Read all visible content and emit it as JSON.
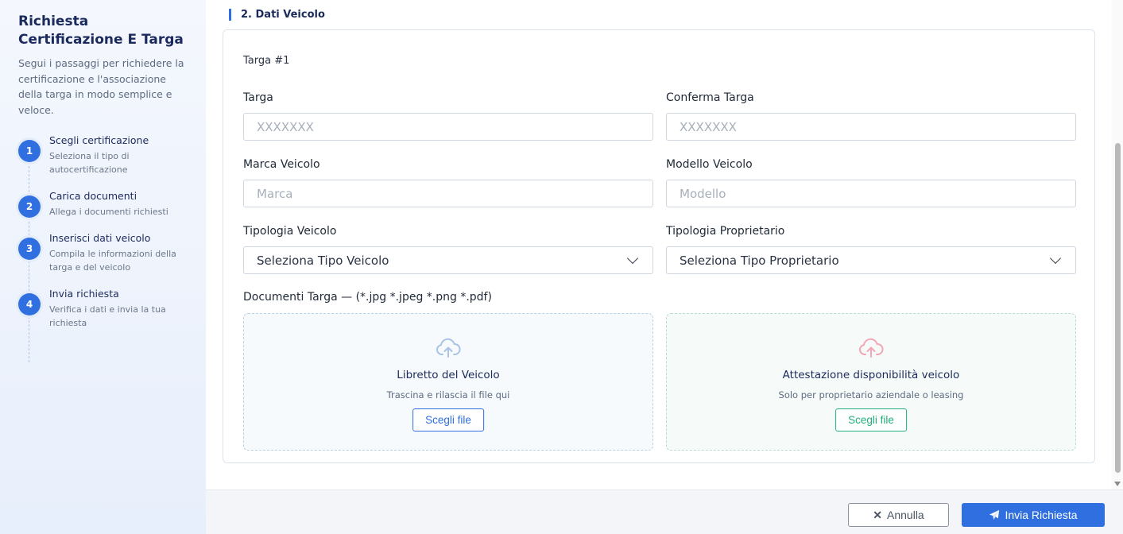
{
  "sidebar": {
    "title": "Richiesta Certificazione E Targa",
    "description": "Segui i passaggi per richiedere la certificazione e l'associazione della targa in modo semplice e veloce.",
    "steps": [
      {
        "num": "1",
        "title": "Scegli certificazione",
        "subtitle": "Seleziona il tipo di autocertificazione"
      },
      {
        "num": "2",
        "title": "Carica documenti",
        "subtitle": "Allega i documenti richiesti"
      },
      {
        "num": "3",
        "title": "Inserisci dati veicolo",
        "subtitle": "Compila le informazioni della targa e del veicolo"
      },
      {
        "num": "4",
        "title": "Invia richiesta",
        "subtitle": "Verifica i dati e invia la tua richiesta"
      }
    ]
  },
  "section": {
    "title": "2. Dati Veicolo"
  },
  "form": {
    "heading": "Targa #1",
    "targa": {
      "label": "Targa",
      "placeholder": "XXXXXXX",
      "value": ""
    },
    "conferma_targa": {
      "label": "Conferma Targa",
      "placeholder": "XXXXXXX",
      "value": ""
    },
    "marca": {
      "label": "Marca Veicolo",
      "placeholder": "Marca",
      "value": ""
    },
    "modello": {
      "label": "Modello Veicolo",
      "placeholder": "Modello",
      "value": ""
    },
    "tipologia_veicolo": {
      "label": "Tipologia Veicolo",
      "selected": "Seleziona Tipo Veicolo"
    },
    "tipologia_proprietario": {
      "label": "Tipologia Proprietario",
      "selected": "Seleziona Tipo Proprietario"
    },
    "documenti": {
      "label": "Documenti Targa",
      "formats": " — (*.jpg *.jpeg *.png *.pdf)",
      "libretto": {
        "title": "Libretto del Veicolo",
        "subtitle": "Trascina e rilascia il file qui",
        "button": "Scegli file"
      },
      "attestazione": {
        "title": "Attestazione disponibilità veicolo",
        "subtitle": "Solo per proprietario aziendale o leasing",
        "button": "Scegli file"
      }
    }
  },
  "footer": {
    "cancel_label": "Annulla",
    "send_label": "Invia Richiesta"
  },
  "colors": {
    "accent": "#2f6fe0",
    "success": "#21b07a",
    "upload_blue": "#a9c3e6",
    "upload_pink": "#f3a6b5"
  },
  "icons": {
    "upload": "cloud-upload-icon",
    "cancel": "close-icon",
    "send": "paper-plane-icon",
    "dropdown": "chevron-down-icon"
  }
}
